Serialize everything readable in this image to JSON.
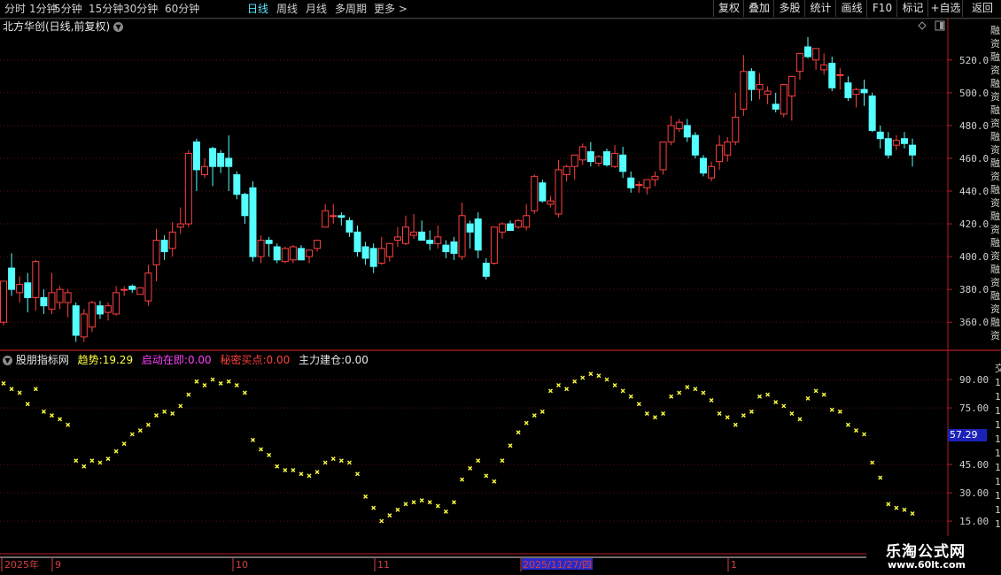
{
  "toolbar": {
    "items": [
      "分时",
      "1分钟",
      "5分钟",
      "15分钟",
      "30分钟",
      "60分钟",
      "日线",
      "周线",
      "月线",
      "多周期",
      "更多 >"
    ],
    "active": "日线",
    "right": [
      "复权",
      "叠加",
      "多股",
      "统计",
      "画线",
      "F10",
      "标记",
      "+自选",
      "返回"
    ]
  },
  "stock_title": "北方华创(日线,前复权)",
  "main_axis_labels": [
    "520.0",
    "500.0",
    "480.0",
    "460.0",
    "440.0",
    "420.0",
    "400.0",
    "380.0",
    "360.0"
  ],
  "right_edge_chars": "融资融资融资融资融资融资融资融资融资融资融资融资",
  "indicator": {
    "name": "股朋指标网",
    "trend_label": "趋势:",
    "trend_value": "19.29",
    "start_label": "启动在即:",
    "start_value": "0.00",
    "secret_label": "秘密买点:",
    "secret_value": "0.00",
    "main_label": "主力建仓:",
    "main_value": "0.00",
    "last_value": "57.29",
    "axis_labels": [
      "90.00",
      "75.00",
      "45.00",
      "30.00",
      "15.00"
    ]
  },
  "date_axis": {
    "labels": [
      "2025年",
      "9",
      "10",
      "11",
      "2025/11/27/四",
      "1"
    ]
  },
  "watermark": {
    "line1": "乐淘公式网",
    "line2": "www.60lt.com"
  },
  "colors": {
    "up": "#ff4040",
    "down": "#54ffff",
    "indicator_dot": "#ffff40",
    "panel_border": "#b81e1e"
  },
  "chart_data": [
    {
      "type": "candlestick",
      "title": "北方华创(日线,前复权)",
      "ylim": [
        345,
        535
      ],
      "yticks": [
        360,
        380,
        400,
        420,
        440,
        460,
        480,
        500,
        520
      ],
      "candles": [
        {
          "o": 360,
          "h": 385,
          "l": 358,
          "c": 385
        },
        {
          "o": 393,
          "h": 402,
          "l": 376,
          "c": 380
        },
        {
          "o": 378,
          "h": 388,
          "l": 372,
          "c": 383
        },
        {
          "o": 384,
          "h": 390,
          "l": 366,
          "c": 375
        },
        {
          "o": 375,
          "h": 398,
          "l": 367,
          "c": 397
        },
        {
          "o": 375,
          "h": 380,
          "l": 365,
          "c": 370
        },
        {
          "o": 368,
          "h": 390,
          "l": 365,
          "c": 378
        },
        {
          "o": 372,
          "h": 382,
          "l": 368,
          "c": 380
        },
        {
          "o": 372,
          "h": 380,
          "l": 363,
          "c": 378
        },
        {
          "o": 370,
          "h": 372,
          "l": 348,
          "c": 352
        },
        {
          "o": 351,
          "h": 368,
          "l": 348,
          "c": 365
        },
        {
          "o": 357,
          "h": 373,
          "l": 354,
          "c": 372
        },
        {
          "o": 370,
          "h": 373,
          "l": 362,
          "c": 365
        },
        {
          "o": 366,
          "h": 372,
          "l": 361,
          "c": 370
        },
        {
          "o": 365,
          "h": 382,
          "l": 364,
          "c": 378
        },
        {
          "o": 380,
          "h": 382,
          "l": 376,
          "c": 380
        },
        {
          "o": 382,
          "h": 383,
          "l": 378,
          "c": 380
        },
        {
          "o": 377,
          "h": 381,
          "l": 378,
          "c": 381
        },
        {
          "o": 373,
          "h": 395,
          "l": 370,
          "c": 390
        },
        {
          "o": 395,
          "h": 417,
          "l": 385,
          "c": 410
        },
        {
          "o": 410,
          "h": 413,
          "l": 398,
          "c": 403
        },
        {
          "o": 405,
          "h": 421,
          "l": 400,
          "c": 415
        },
        {
          "o": 418,
          "h": 430,
          "l": 414,
          "c": 420
        },
        {
          "o": 420,
          "h": 465,
          "l": 418,
          "c": 463
        },
        {
          "o": 470,
          "h": 472,
          "l": 440,
          "c": 453
        },
        {
          "o": 450,
          "h": 460,
          "l": 448,
          "c": 455
        },
        {
          "o": 466,
          "h": 467,
          "l": 443,
          "c": 455
        },
        {
          "o": 463,
          "h": 465,
          "l": 451,
          "c": 455
        },
        {
          "o": 460,
          "h": 474,
          "l": 440,
          "c": 455
        },
        {
          "o": 450,
          "h": 452,
          "l": 435,
          "c": 438
        },
        {
          "o": 438,
          "h": 439,
          "l": 420,
          "c": 425
        },
        {
          "o": 442,
          "h": 446,
          "l": 397,
          "c": 400
        },
        {
          "o": 400,
          "h": 413,
          "l": 396,
          "c": 410
        },
        {
          "o": 410,
          "h": 412,
          "l": 400,
          "c": 408
        },
        {
          "o": 406,
          "h": 408,
          "l": 396,
          "c": 398
        },
        {
          "o": 397,
          "h": 406,
          "l": 396,
          "c": 405
        },
        {
          "o": 398,
          "h": 407,
          "l": 396,
          "c": 406
        },
        {
          "o": 405,
          "h": 407,
          "l": 398,
          "c": 398
        },
        {
          "o": 400,
          "h": 404,
          "l": 396,
          "c": 404
        },
        {
          "o": 405,
          "h": 410,
          "l": 403,
          "c": 410
        },
        {
          "o": 418,
          "h": 432,
          "l": 418,
          "c": 428
        },
        {
          "o": 425,
          "h": 432,
          "l": 420,
          "c": 425
        },
        {
          "o": 425,
          "h": 427,
          "l": 419,
          "c": 424
        },
        {
          "o": 422,
          "h": 424,
          "l": 412,
          "c": 415
        },
        {
          "o": 415,
          "h": 419,
          "l": 400,
          "c": 403
        },
        {
          "o": 406,
          "h": 409,
          "l": 395,
          "c": 399
        },
        {
          "o": 405,
          "h": 408,
          "l": 390,
          "c": 394
        },
        {
          "o": 396,
          "h": 412,
          "l": 395,
          "c": 405
        },
        {
          "o": 400,
          "h": 408,
          "l": 397,
          "c": 408
        },
        {
          "o": 410,
          "h": 418,
          "l": 406,
          "c": 412
        },
        {
          "o": 408,
          "h": 425,
          "l": 407,
          "c": 418
        },
        {
          "o": 413,
          "h": 426,
          "l": 411,
          "c": 415
        },
        {
          "o": 415,
          "h": 422,
          "l": 412,
          "c": 410
        },
        {
          "o": 410,
          "h": 416,
          "l": 404,
          "c": 408
        },
        {
          "o": 408,
          "h": 419,
          "l": 405,
          "c": 412
        },
        {
          "o": 407,
          "h": 410,
          "l": 399,
          "c": 403
        },
        {
          "o": 409,
          "h": 412,
          "l": 398,
          "c": 402
        },
        {
          "o": 400,
          "h": 433,
          "l": 398,
          "c": 425
        },
        {
          "o": 420,
          "h": 422,
          "l": 405,
          "c": 415
        },
        {
          "o": 423,
          "h": 427,
          "l": 399,
          "c": 404
        },
        {
          "o": 396,
          "h": 399,
          "l": 386,
          "c": 388
        },
        {
          "o": 396,
          "h": 418,
          "l": 395,
          "c": 418
        },
        {
          "o": 415,
          "h": 421,
          "l": 411,
          "c": 420
        },
        {
          "o": 420,
          "h": 422,
          "l": 417,
          "c": 416
        },
        {
          "o": 418,
          "h": 423,
          "l": 417,
          "c": 422
        },
        {
          "o": 418,
          "h": 432,
          "l": 416,
          "c": 425
        },
        {
          "o": 428,
          "h": 450,
          "l": 426,
          "c": 449
        },
        {
          "o": 445,
          "h": 447,
          "l": 433,
          "c": 434
        },
        {
          "o": 432,
          "h": 437,
          "l": 430,
          "c": 434
        },
        {
          "o": 426,
          "h": 459,
          "l": 424,
          "c": 453
        },
        {
          "o": 450,
          "h": 456,
          "l": 446,
          "c": 455
        },
        {
          "o": 455,
          "h": 462,
          "l": 447,
          "c": 462
        },
        {
          "o": 459,
          "h": 469,
          "l": 456,
          "c": 467
        },
        {
          "o": 464,
          "h": 470,
          "l": 455,
          "c": 458
        },
        {
          "o": 457,
          "h": 462,
          "l": 455,
          "c": 461
        },
        {
          "o": 464,
          "h": 466,
          "l": 455,
          "c": 456
        },
        {
          "o": 455,
          "h": 468,
          "l": 454,
          "c": 463
        },
        {
          "o": 462,
          "h": 467,
          "l": 448,
          "c": 452
        },
        {
          "o": 448,
          "h": 452,
          "l": 439,
          "c": 442
        },
        {
          "o": 444,
          "h": 446,
          "l": 439,
          "c": 444
        },
        {
          "o": 442,
          "h": 447,
          "l": 438,
          "c": 447
        },
        {
          "o": 447,
          "h": 452,
          "l": 443,
          "c": 449
        },
        {
          "o": 453,
          "h": 465,
          "l": 450,
          "c": 470
        },
        {
          "o": 470,
          "h": 486,
          "l": 468,
          "c": 480
        },
        {
          "o": 478,
          "h": 484,
          "l": 476,
          "c": 482
        },
        {
          "o": 480,
          "h": 484,
          "l": 470,
          "c": 473
        },
        {
          "o": 474,
          "h": 476,
          "l": 460,
          "c": 462
        },
        {
          "o": 460,
          "h": 462,
          "l": 449,
          "c": 451
        },
        {
          "o": 448,
          "h": 458,
          "l": 446,
          "c": 455
        },
        {
          "o": 458,
          "h": 474,
          "l": 453,
          "c": 468
        },
        {
          "o": 462,
          "h": 473,
          "l": 458,
          "c": 470
        },
        {
          "o": 470,
          "h": 500,
          "l": 468,
          "c": 485
        },
        {
          "o": 490,
          "h": 523,
          "l": 486,
          "c": 513
        },
        {
          "o": 513,
          "h": 515,
          "l": 495,
          "c": 502
        },
        {
          "o": 502,
          "h": 512,
          "l": 496,
          "c": 505
        },
        {
          "o": 499,
          "h": 504,
          "l": 493,
          "c": 501
        },
        {
          "o": 493,
          "h": 500,
          "l": 488,
          "c": 490
        },
        {
          "o": 487,
          "h": 504,
          "l": 485,
          "c": 505
        },
        {
          "o": 498,
          "h": 509,
          "l": 483,
          "c": 510
        },
        {
          "o": 513,
          "h": 520,
          "l": 508,
          "c": 524
        },
        {
          "o": 528,
          "h": 534,
          "l": 521,
          "c": 522
        },
        {
          "o": 520,
          "h": 524,
          "l": 514,
          "c": 527
        },
        {
          "o": 514,
          "h": 524,
          "l": 511,
          "c": 517
        },
        {
          "o": 518,
          "h": 522,
          "l": 501,
          "c": 503
        },
        {
          "o": 511,
          "h": 515,
          "l": 502,
          "c": 511
        },
        {
          "o": 506,
          "h": 510,
          "l": 495,
          "c": 497
        },
        {
          "o": 499,
          "h": 503,
          "l": 491,
          "c": 502
        },
        {
          "o": 502,
          "h": 508,
          "l": 492,
          "c": 500
        },
        {
          "o": 498,
          "h": 500,
          "l": 476,
          "c": 477
        },
        {
          "o": 476,
          "h": 480,
          "l": 466,
          "c": 472
        },
        {
          "o": 472,
          "h": 476,
          "l": 460,
          "c": 462
        },
        {
          "o": 468,
          "h": 474,
          "l": 465,
          "c": 471
        },
        {
          "o": 472,
          "h": 476,
          "l": 466,
          "c": 469
        },
        {
          "o": 468,
          "h": 472,
          "l": 455,
          "c": 462
        }
      ]
    },
    {
      "type": "scatter",
      "title": "股朋指标网",
      "ylim": [
        8,
        98
      ],
      "yticks": [
        15,
        30,
        45,
        75,
        90
      ],
      "series": [
        {
          "name": "趋势",
          "values": [
            88,
            85,
            83,
            77,
            85,
            73,
            71,
            69,
            66,
            47,
            44,
            47,
            46,
            48,
            52,
            56,
            61,
            63,
            66,
            71,
            73,
            72,
            76,
            82,
            89,
            87,
            90,
            88,
            89,
            87,
            83,
            58,
            53,
            50,
            44,
            42,
            42,
            40,
            39,
            41,
            46,
            48,
            47,
            46,
            40,
            28,
            22,
            15,
            18,
            21,
            24,
            25,
            26,
            25,
            23,
            20,
            25,
            37,
            43,
            47,
            39,
            36,
            47,
            55,
            62,
            67,
            71,
            73,
            84,
            87,
            85,
            89,
            91,
            93,
            92,
            90,
            87,
            84,
            81,
            77,
            72,
            70,
            72,
            81,
            83,
            86,
            85,
            83,
            79,
            72,
            70,
            66,
            71,
            73,
            81,
            82,
            78,
            76,
            72,
            69,
            80,
            84,
            82,
            74,
            73,
            66,
            63,
            61,
            46,
            38,
            24,
            22,
            21,
            19
          ]
        }
      ]
    }
  ]
}
